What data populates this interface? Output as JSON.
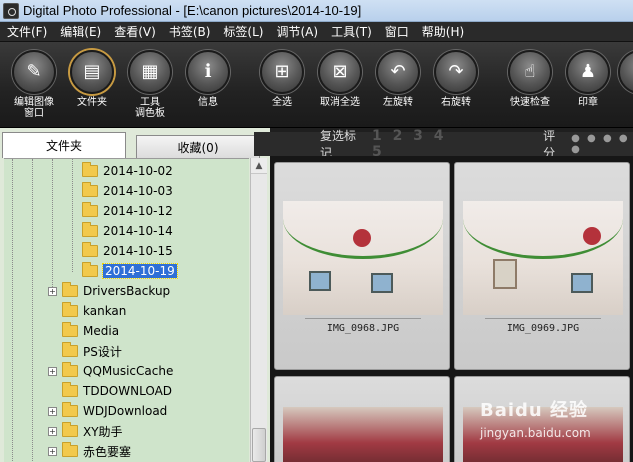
{
  "window": {
    "title": "Digital Photo Professional - [E:\\canon pictures\\2014-10-19]"
  },
  "menu": [
    "文件(F)",
    "编辑(E)",
    "查看(V)",
    "书签(B)",
    "标签(L)",
    "调节(A)",
    "工具(T)",
    "窗口",
    "帮助(H)"
  ],
  "toolbar": {
    "edit_window": "编辑图像\n窗口",
    "folder": "文件夹",
    "tool_palette": "工具\n调色板",
    "info": "信息",
    "select_all": "全选",
    "deselect_all": "取消全选",
    "rotate_left": "左旋转",
    "rotate_right": "右旋转",
    "quick_check": "快速检查",
    "print": "印章"
  },
  "tabs": {
    "folders": "文件夹",
    "favorites": "收藏(0)"
  },
  "tree": {
    "items": [
      "2014-10-02",
      "2014-10-03",
      "2014-10-12",
      "2014-10-14",
      "2014-10-15",
      "2014-10-19",
      "DriversBackup",
      "kankan",
      "Media",
      "PS设计",
      "QQMusicCache",
      "TDDOWNLOAD",
      "WDJDownload",
      "XY助手",
      "赤色要塞"
    ],
    "selected": "2014-10-19"
  },
  "header": {
    "check_marks": "复选标记",
    "check_numbers": "1 2 3 4 5",
    "rating": "评分",
    "rating_dots": "● ● ● ● ●"
  },
  "thumbnails": [
    {
      "filename": "IMG_0968.JPG"
    },
    {
      "filename": "IMG_0969.JPG"
    }
  ],
  "watermark": {
    "brand": "Baidu 经验",
    "url": "jingyan.baidu.com"
  }
}
